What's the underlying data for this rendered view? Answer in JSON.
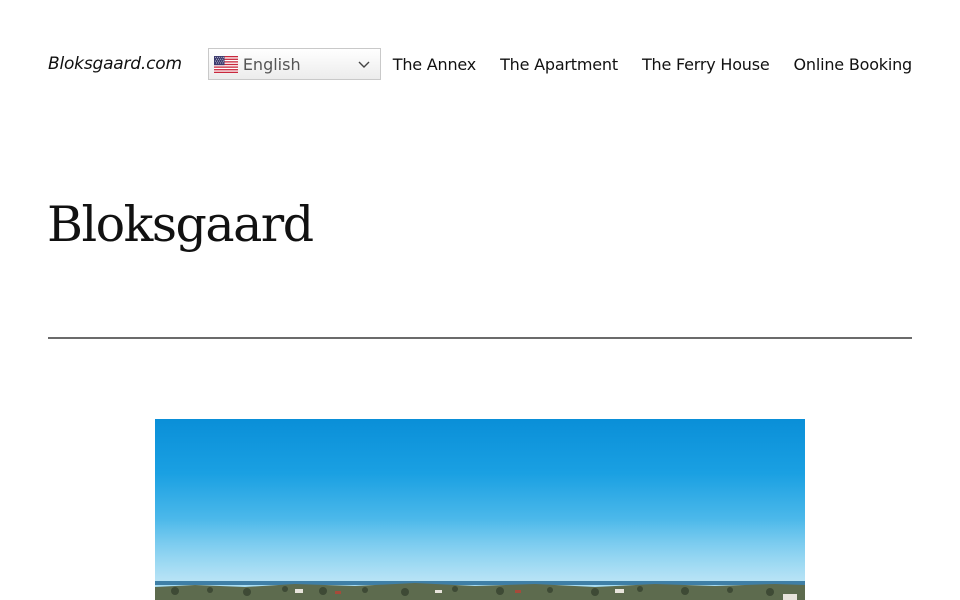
{
  "header": {
    "site_title": "Bloksgaard.com",
    "language": {
      "selected": "English",
      "flag_icon": "us-flag-icon",
      "chevron_icon": "chevron-down-icon"
    },
    "nav": [
      {
        "label": "The Annex"
      },
      {
        "label": "The Apartment"
      },
      {
        "label": "The Ferry House"
      },
      {
        "label": "Online Booking"
      }
    ]
  },
  "main": {
    "page_title": "Bloksgaard",
    "hero_image": {
      "description": "Aerial landscape photo with blue sky and coastline"
    }
  },
  "colors": {
    "text": "#111111",
    "divider": "#6b6b6b",
    "sky_top": "#0a8fd8",
    "sky_bottom": "#b6e2f4"
  }
}
